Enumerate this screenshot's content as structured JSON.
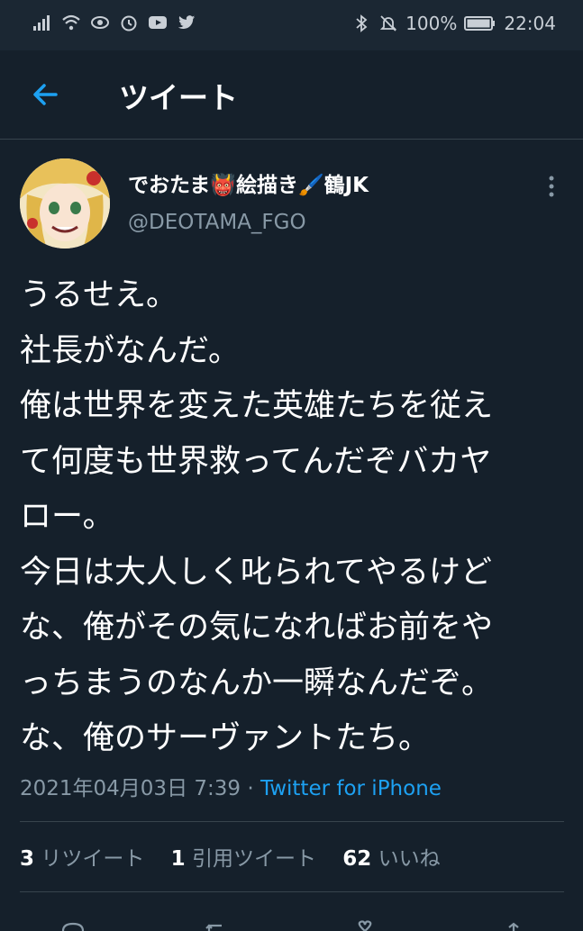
{
  "status_bar": {
    "battery": "100%",
    "time": "22:04"
  },
  "header": {
    "title": "ツイート",
    "back_icon": "arrow-left-icon"
  },
  "tweet": {
    "display_name": "でおたま👹絵描き🖌️鶴JK",
    "handle": "@DEOTAMA_FGO",
    "lines": [
      "うるせえ。",
      "社長がなんだ。",
      "俺は世界を変えた英雄たちを従え",
      "て何度も世界救ってんだぞバカヤ",
      "ロー。",
      "今日は大人しく叱られてやるけど",
      "な、俺がその気になればお前をや",
      "っちまうのなんか一瞬なんだぞ。",
      "な、俺のサーヴァントたち。"
    ],
    "timestamp": "2021年04月03日 7:39",
    "separator": " · ",
    "source": "Twitter for iPhone"
  },
  "stats": {
    "retweets": {
      "count": "3",
      "label": "リツイート"
    },
    "quotes": {
      "count": "1",
      "label": "引用ツイート"
    },
    "likes": {
      "count": "62",
      "label": "いいね"
    }
  },
  "colors": {
    "background": "#15202b",
    "accent": "#1da1f2",
    "muted": "#8899a6"
  }
}
